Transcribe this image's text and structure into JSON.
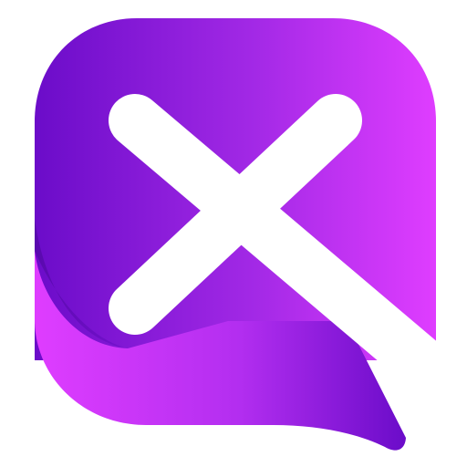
{
  "logo": {
    "icon": "x-chat-bubble-icon",
    "colors": {
      "purple_dark": "#6b0cc9",
      "purple_mid": "#a329e6",
      "magenta": "#df3dff",
      "mark": "#ffffff"
    }
  }
}
